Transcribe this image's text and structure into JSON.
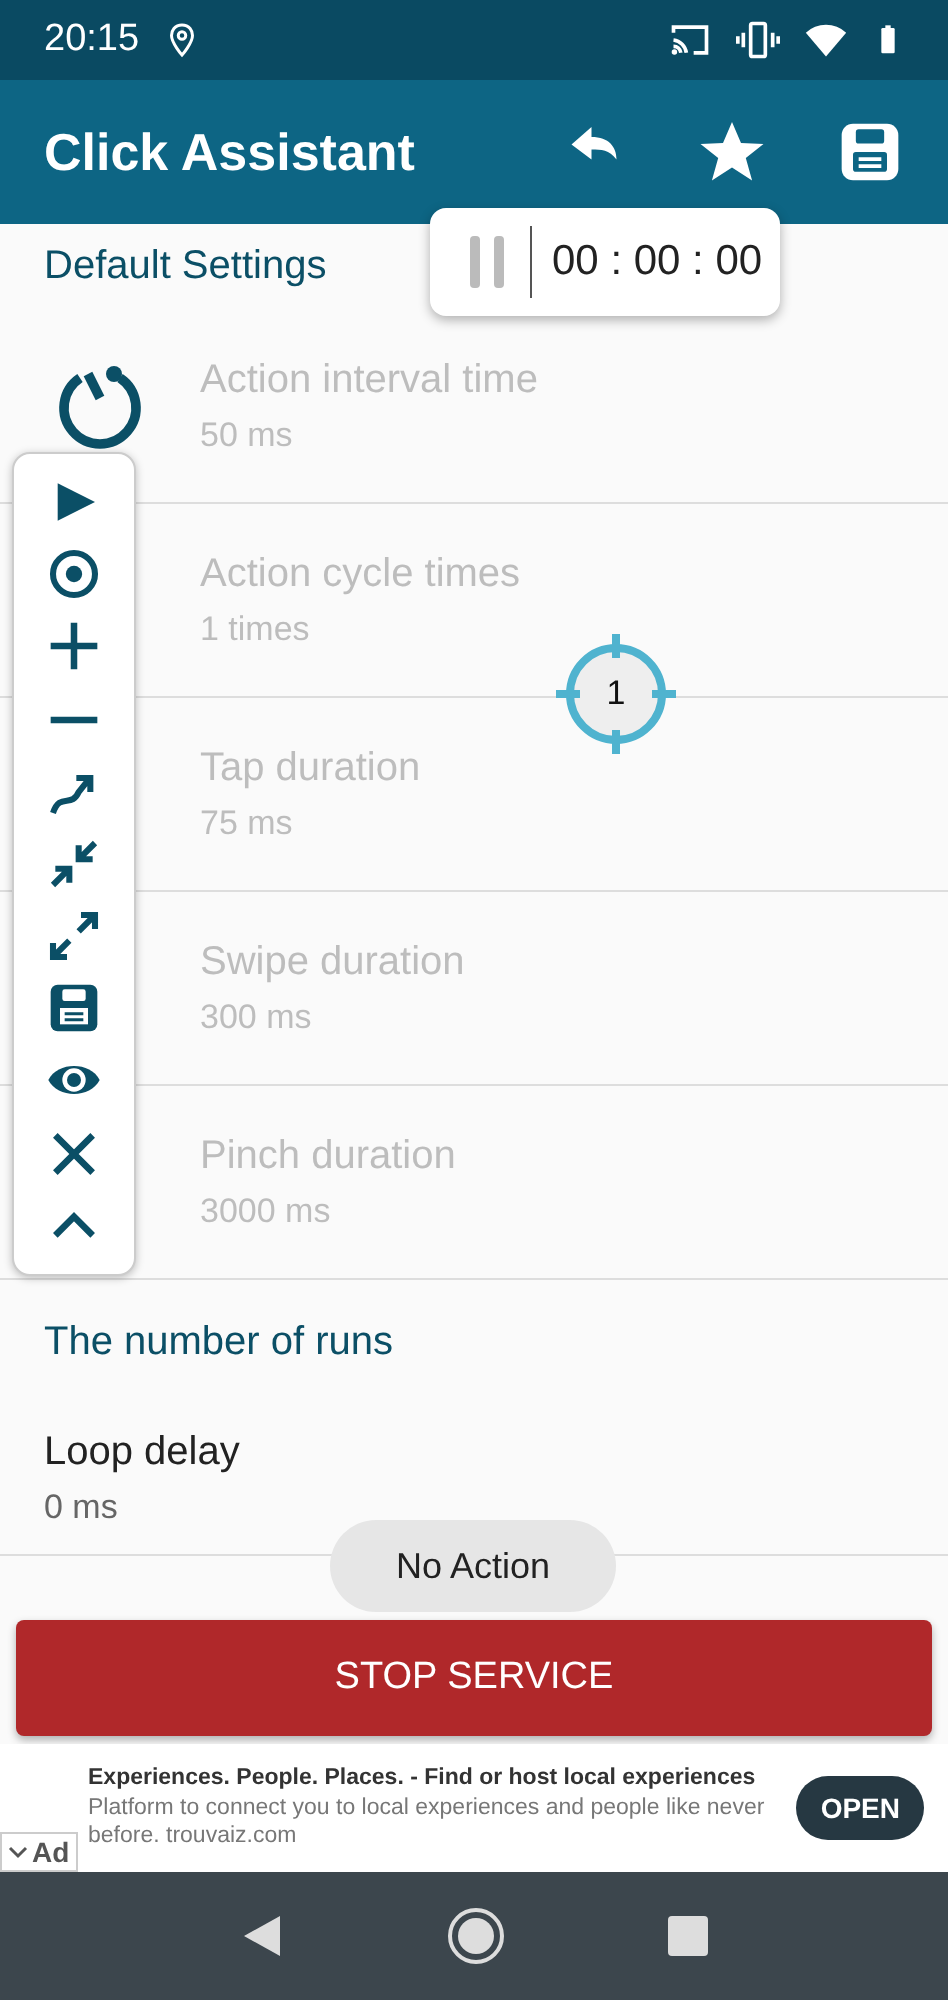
{
  "status_bar": {
    "time": "20:15"
  },
  "app_bar": {
    "title": "Click Assistant"
  },
  "timer": {
    "time": "00 : 00 : 00"
  },
  "default_settings": {
    "title": "Default Settings",
    "items": [
      {
        "title": "Action interval time",
        "value": "50 ms",
        "disabled": true
      },
      {
        "title": "Action cycle times",
        "value": "1 times",
        "disabled": true
      },
      {
        "title": "Tap duration",
        "value": "75 ms",
        "disabled": true
      },
      {
        "title": "Swipe duration",
        "value": "300 ms",
        "disabled": true
      },
      {
        "title": "Pinch duration",
        "value": "3000 ms",
        "disabled": true
      }
    ]
  },
  "runs": {
    "title": "The number of runs",
    "items": [
      {
        "title": "Loop delay",
        "value": "0 ms",
        "disabled": false
      }
    ]
  },
  "target": {
    "label": "1"
  },
  "stop_button": {
    "label": "STOP SERVICE"
  },
  "toast": {
    "text": "No Action"
  },
  "ad": {
    "headline": "Experiences. People. Places. - Find or host local experiences",
    "body": "Platform to connect you to local experiences and people like never before. trouvaiz.com",
    "badge": "Ad",
    "button": "OPEN"
  }
}
